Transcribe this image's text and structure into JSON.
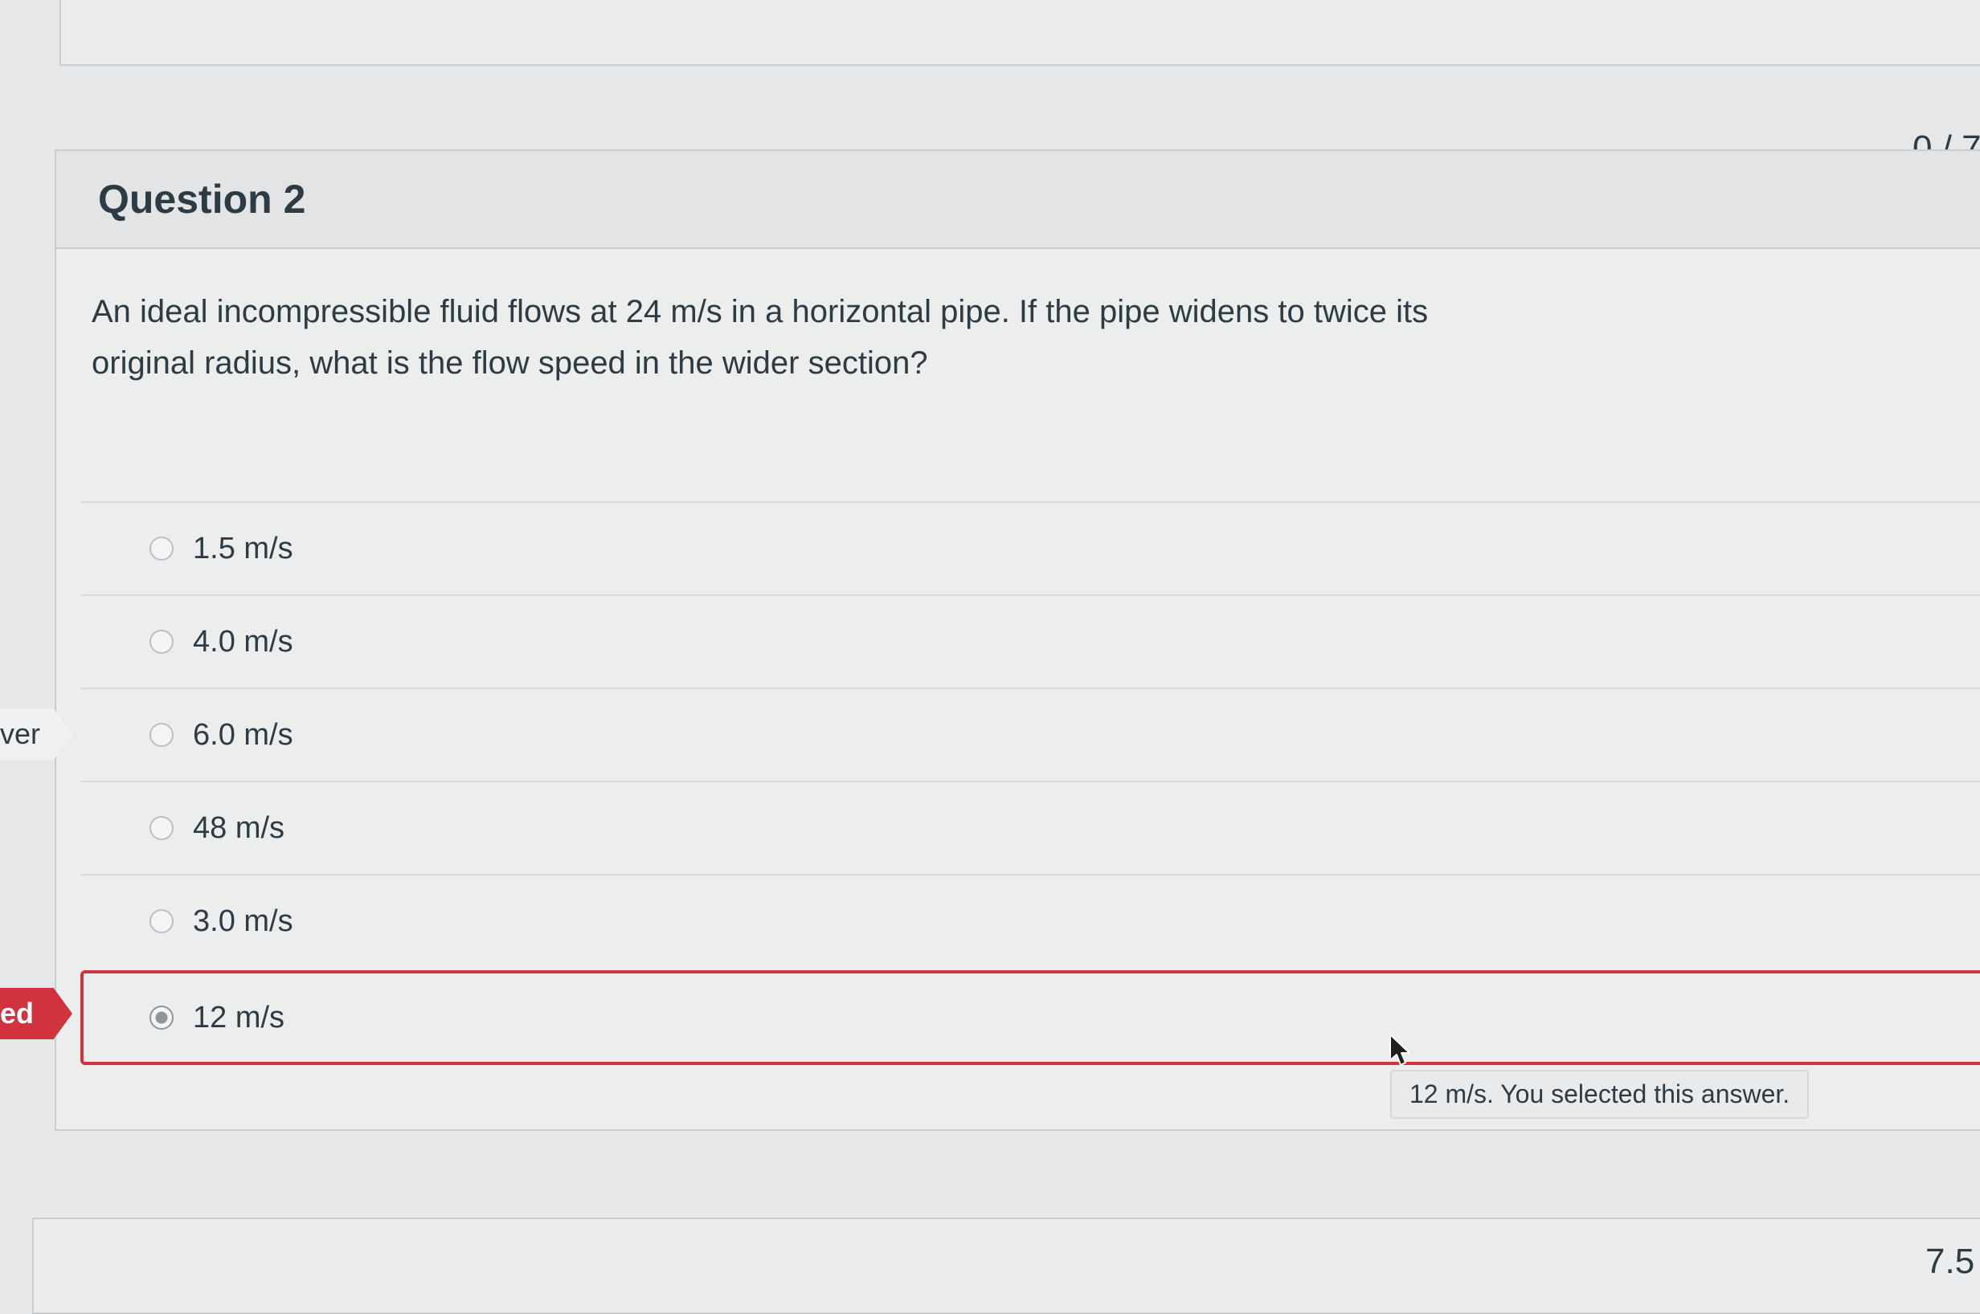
{
  "question": {
    "title": "Question 2",
    "score": "0 / 7",
    "text": "An ideal incompressible fluid flows at 24 m/s in a horizontal pipe. If the pipe widens to twice its original radius, what is the flow speed in the wider section?",
    "answers": [
      {
        "label": "1.5 m/s",
        "selected": false
      },
      {
        "label": "4.0 m/s",
        "selected": false
      },
      {
        "label": "6.0 m/s",
        "selected": false
      },
      {
        "label": "48 m/s",
        "selected": false
      },
      {
        "label": "3.0 m/s",
        "selected": false
      },
      {
        "label": "12 m/s",
        "selected": true
      }
    ]
  },
  "side_tags": {
    "correct_answer": "ver",
    "incorrect": "ed"
  },
  "tooltip": {
    "text": "12 m/s. You selected this answer."
  },
  "next_question": {
    "score_partial": "7.5"
  },
  "colors": {
    "incorrect": "#d0323e",
    "text": "#2d3b45"
  },
  "icons": {
    "cursor": "mouse-pointer-icon"
  }
}
